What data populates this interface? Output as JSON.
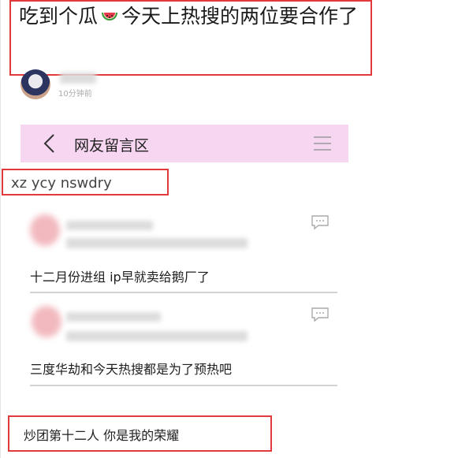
{
  "headline": {
    "text_before": "吃到个瓜",
    "emoji_icon": "watermelon-icon",
    "text_after": "今天上热搜的两位要合作了"
  },
  "post_meta": {
    "time_text": "10分钟前"
  },
  "navbar": {
    "title": "网友留言区",
    "back_icon": "chevron-left-icon",
    "menu_icon": "hamburger-menu-icon",
    "background": "#f6d6f0"
  },
  "tag": {
    "text": "xz ycy nswdry"
  },
  "comments": [
    {
      "text": "十二月份进组 ip早就卖给鹅厂了",
      "icon": "comment-icon"
    },
    {
      "text": "三度华劫和今天热搜都是为了预热吧",
      "icon": "comment-icon"
    }
  ],
  "bottom_caption": {
    "text": "炒团第十二人 你是我的荣耀"
  },
  "colors": {
    "highlight_border": "#e23a3a",
    "divider": "#d3d3d3"
  }
}
